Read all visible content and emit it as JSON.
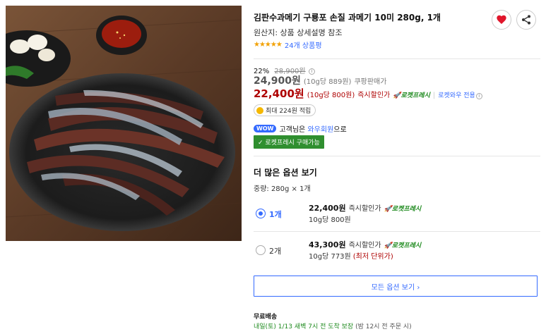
{
  "product": {
    "title": "김판수과메기 구룡포 손질 과메기 10미 280g, 1개",
    "origin": "원산지: 상품 상세설명 참조",
    "rating_stars": "★★★★★",
    "review_count": "24개 상품평"
  },
  "pricing": {
    "discount_rate": "22%",
    "original_price": "28,900원",
    "original_info_icon": "i",
    "price": "24,900원",
    "unit_price": "(10g당 889원)",
    "price_label": "쿠팡판매가",
    "sale_price": "22,400원",
    "sale_unit_price": "(10g당 800원)",
    "sale_label": "즉시할인가",
    "rocket_label": "로켓프레시",
    "separator": "|",
    "wow_label": "로켓와우 전용",
    "wow_info_icon": "i"
  },
  "reward": {
    "text": "최대 224원 적립"
  },
  "membership": {
    "badge": "WOW",
    "prefix": "고객님은",
    "link": "와우회원",
    "suffix": "으로"
  },
  "express_button": "✓ 로켓프레시 구매가능",
  "options": {
    "heading": "더 많은 옵션 보기",
    "spec": "중량: 280g × 1개",
    "items": [
      {
        "qty": "1개",
        "price": "22,400원",
        "label": "즉시할인가",
        "rocket": "로켓프레시",
        "unit": "10g당 800원",
        "lowest": "",
        "selected": true
      },
      {
        "qty": "2개",
        "price": "43,300원",
        "label": "즉시할인가",
        "rocket": "로켓프레시",
        "unit": "10g당 773원",
        "lowest": "(최저 단위가)",
        "selected": false
      }
    ],
    "all_options_button": "모든 옵션 보기 ›"
  },
  "shipping": {
    "label": "무료배송",
    "date": "내일(토) 1/13 새벽 7시 전 ",
    "guarantee": "도착 보장",
    "note": " (밤 12시 전 주문 시)"
  },
  "colors": {
    "accent_blue": "#346aff",
    "sale_red": "#ae0000",
    "rocket_green": "#2f8f2f",
    "star_orange": "#f2a100"
  },
  "icons": {
    "wish": "heart-icon",
    "share": "share-icon",
    "rocket": "rocket-icon",
    "coin": "coin-icon"
  }
}
